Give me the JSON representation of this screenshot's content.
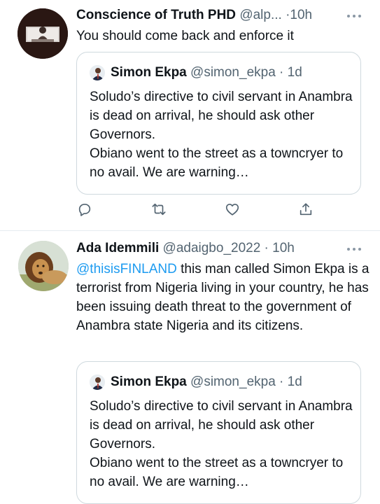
{
  "tweets": [
    {
      "author_name": "Conscience of Truth PHD",
      "handle_time": "@alp... ·10h",
      "avatar_icon": "person-at-desk-avatar",
      "text": "You should come back and enforce it",
      "quote": {
        "author_name": "Simon Ekpa",
        "handle_time": "@simon_ekpa · 1d",
        "avatar_icon": "man-in-suit-avatar",
        "text": "Soludo’s directive to civil servant in Anambra is dead on arrival, he should ask other Governors.\nObiano went to the street as a towncryer to no avail. We are warning…"
      },
      "actions": [
        "reply-icon",
        "retweet-icon",
        "like-icon",
        "share-icon"
      ]
    },
    {
      "author_name": "Ada Idemmili",
      "handle_time": "@adaigbo_2022 · 10h",
      "avatar_icon": "lion-avatar",
      "mention": "@thisisFINLAND",
      "text": " this man called Simon Ekpa is a terrorist from Nigeria living in your country, he has been issuing death threat to the government of Anambra state Nigeria and its citizens.",
      "quote": {
        "author_name": "Simon Ekpa",
        "handle_time": "@simon_ekpa · 1d",
        "avatar_icon": "man-in-suit-avatar",
        "text": "Soludo’s directive to civil servant in Anambra is dead on arrival, he should ask other Governors.\nObiano went to the street as a towncryer to no avail. We are warning…"
      }
    }
  ],
  "colors": {
    "text": "#0f1419",
    "meta": "#536471",
    "link": "#1d9bf0",
    "border": "#cfd9de",
    "icon": "#536471"
  }
}
